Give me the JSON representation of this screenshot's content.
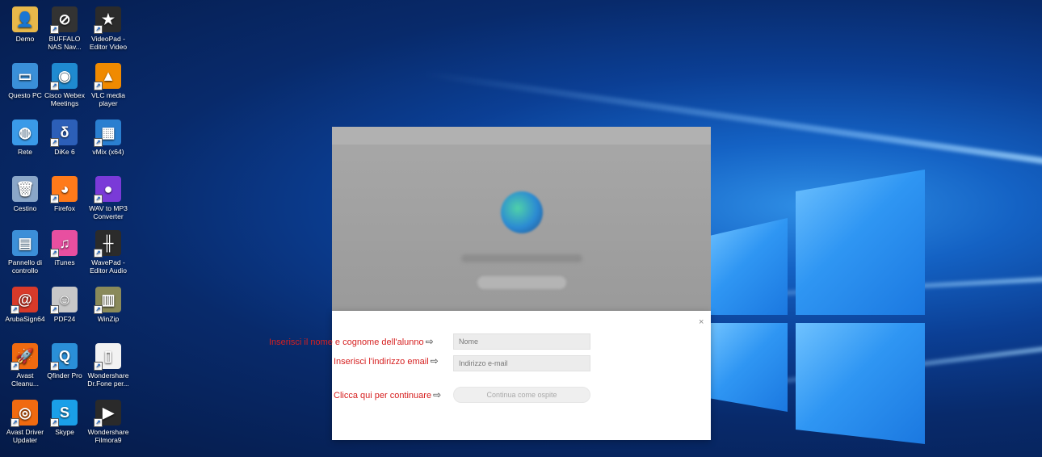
{
  "desktop": {
    "icons": [
      {
        "label": "Demo",
        "icon": "user-folder-icon",
        "color": "#e8b84a",
        "symbol": "👤"
      },
      {
        "label": "BUFFALO NAS Nav...",
        "icon": "buffalo-nas-icon",
        "color": "#333333",
        "symbol": "⊘"
      },
      {
        "label": "VideoPad - Editor Video",
        "icon": "videopad-icon",
        "color": "#2b2b2b",
        "symbol": "★"
      },
      {
        "label": "Questo PC",
        "icon": "computer-icon",
        "color": "#3a8fd8",
        "symbol": "▭"
      },
      {
        "label": "Cisco Webex Meetings",
        "icon": "webex-icon",
        "color": "#1f8ad0",
        "symbol": "◉"
      },
      {
        "label": "VLC media player",
        "icon": "vlc-icon",
        "color": "#f08a00",
        "symbol": "▲"
      },
      {
        "label": "Rete",
        "icon": "network-icon",
        "color": "#3a9ae8",
        "symbol": "◍"
      },
      {
        "label": "DiKe 6",
        "icon": "dike-icon",
        "color": "#2c5fb8",
        "symbol": "δ"
      },
      {
        "label": "vMix (x64)",
        "icon": "vmix-icon",
        "color": "#2a7fd0",
        "symbol": "▦"
      },
      {
        "label": "Cestino",
        "icon": "recycle-bin-icon",
        "color": "#8aa6c8",
        "symbol": "🗑"
      },
      {
        "label": "Firefox",
        "icon": "firefox-icon",
        "color": "#ff7a1a",
        "symbol": "◕"
      },
      {
        "label": "WAV to MP3 Converter",
        "icon": "wav-mp3-icon",
        "color": "#7a3ad8",
        "symbol": "●"
      },
      {
        "label": "Pannello di controllo",
        "icon": "control-panel-icon",
        "color": "#3c8fd8",
        "symbol": "▤"
      },
      {
        "label": "iTunes",
        "icon": "itunes-icon",
        "color": "#e84fa0",
        "symbol": "♫"
      },
      {
        "label": "WavePad - Editor Audio",
        "icon": "wavepad-icon",
        "color": "#2b2b2b",
        "symbol": "╫"
      },
      {
        "label": "ArubaSign64",
        "icon": "arubasign-icon",
        "color": "#d83a2a",
        "symbol": "@"
      },
      {
        "label": "PDF24",
        "icon": "pdf24-icon",
        "color": "#c8c8c8",
        "symbol": "☺"
      },
      {
        "label": "WinZip",
        "icon": "winzip-icon",
        "color": "#8a8a5a",
        "symbol": "▥"
      },
      {
        "label": "Avast Cleanu...",
        "icon": "avast-cleanup-icon",
        "color": "#f06a10",
        "symbol": "🚀"
      },
      {
        "label": "Qfinder Pro",
        "icon": "qfinder-icon",
        "color": "#2a8fd8",
        "symbol": "Q"
      },
      {
        "label": "Wondershare Dr.Fone per...",
        "icon": "document-icon",
        "color": "#f2f2f2",
        "symbol": "▯"
      },
      {
        "label": "Avast Driver Updater",
        "icon": "avast-driver-icon",
        "color": "#f06a10",
        "symbol": "◎"
      },
      {
        "label": "Skype",
        "icon": "skype-icon",
        "color": "#1a9fe8",
        "symbol": "S"
      },
      {
        "label": "Wondershare Filmora9",
        "icon": "filmora-icon",
        "color": "#2a2a2a",
        "symbol": "▶"
      }
    ]
  },
  "dialog": {
    "close": "×",
    "name_placeholder": "Nome",
    "email_placeholder": "Indirizzo e-mail",
    "continue_label": "Continua come ospite"
  },
  "annotations": {
    "name_hint": "Inserisci il nome e cognome dell'alunno",
    "email_hint": "Inserisci l'indirizzo email",
    "continue_hint": "Clicca qui per continuare",
    "arrow": "⇨"
  },
  "colors": {
    "annotation": "#d62020",
    "desktop_dark": "#051a47",
    "desktop_light": "#2f8fe6"
  }
}
